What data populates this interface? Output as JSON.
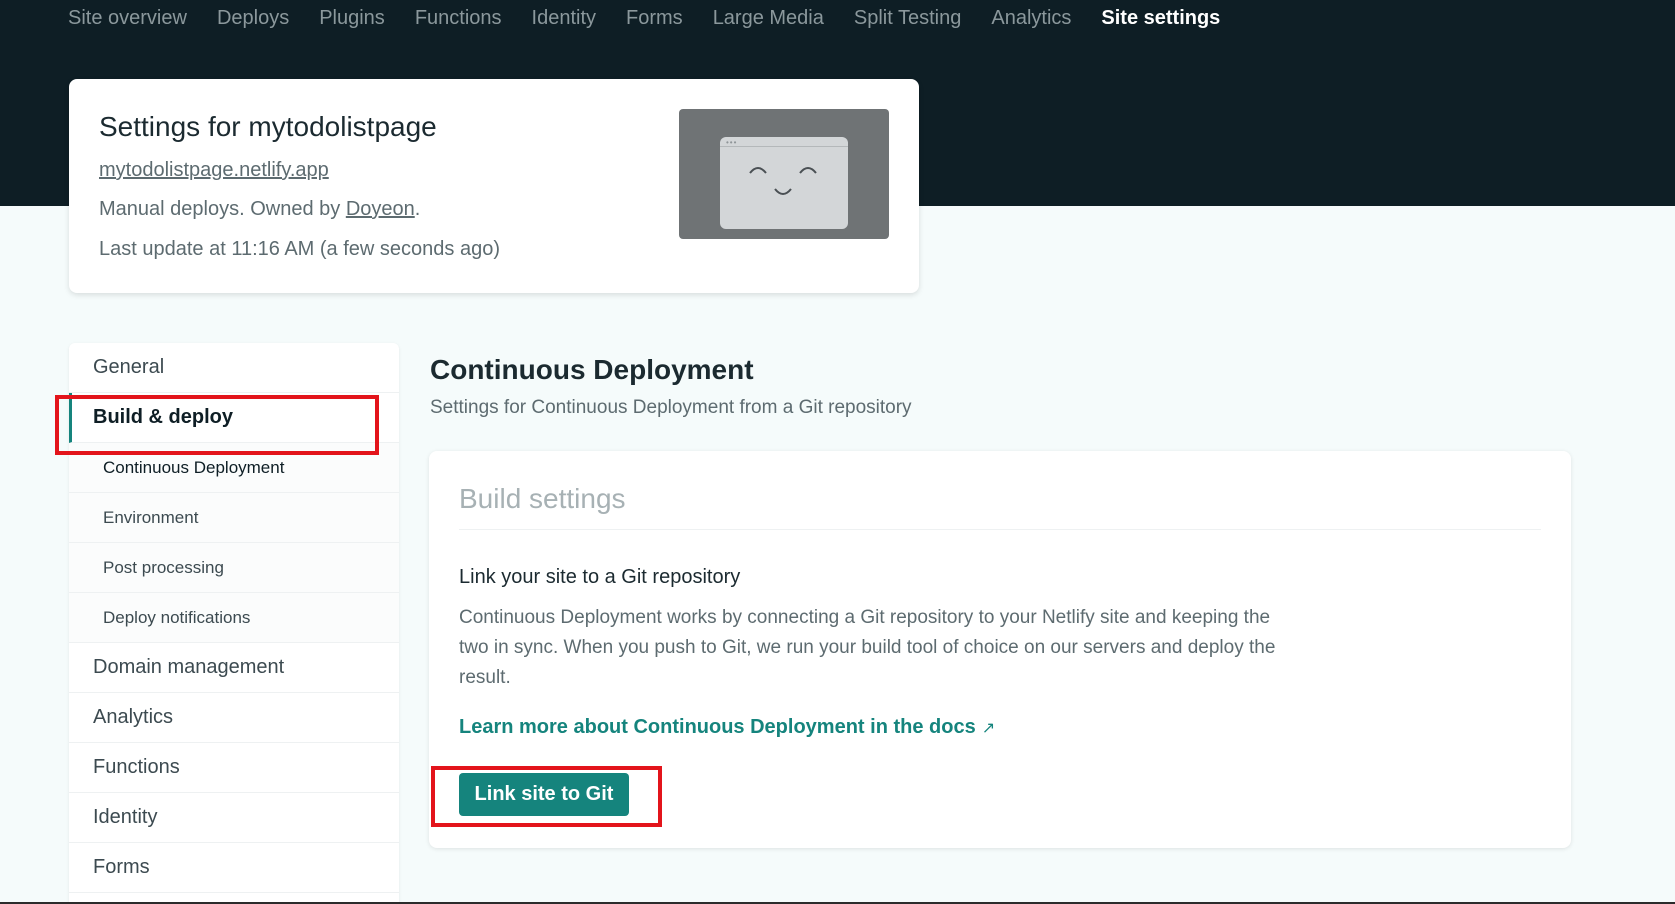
{
  "topnav": {
    "items": [
      "Site overview",
      "Deploys",
      "Plugins",
      "Functions",
      "Identity",
      "Forms",
      "Large Media",
      "Split Testing",
      "Analytics",
      "Site settings"
    ]
  },
  "site": {
    "title": "Settings for mytodolistpage",
    "url": "mytodolistpage.netlify.app",
    "owner_prefix": "Manual deploys. Owned by ",
    "owner_name": "Doyeon",
    "owner_suffix": ".",
    "last_update": "Last update at 11:16 AM (a few seconds ago)"
  },
  "sidebar": {
    "general": "General",
    "build_deploy": "Build & deploy",
    "sub_items": [
      "Continuous Deployment",
      "Environment",
      "Post processing",
      "Deploy notifications"
    ],
    "items_after": [
      "Domain management",
      "Analytics",
      "Functions",
      "Identity",
      "Forms"
    ]
  },
  "main": {
    "title": "Continuous Deployment",
    "subtitle": "Settings for Continuous Deployment from a Git repository",
    "card": {
      "title": "Build settings",
      "link_heading": "Link your site to a Git repository",
      "description": "Continuous Deployment works by connecting a Git repository to your Netlify site and keeping the two in sync. When you push to Git, we run your build tool of choice on our servers and deploy the result.",
      "docs_link": "Learn more about Continuous Deployment in the docs",
      "docs_arrow": "↗",
      "button": "Link site to Git"
    }
  },
  "colors": {
    "header_bg": "#0e1e25",
    "accent": "#15847d",
    "highlight": "#e3141b"
  }
}
